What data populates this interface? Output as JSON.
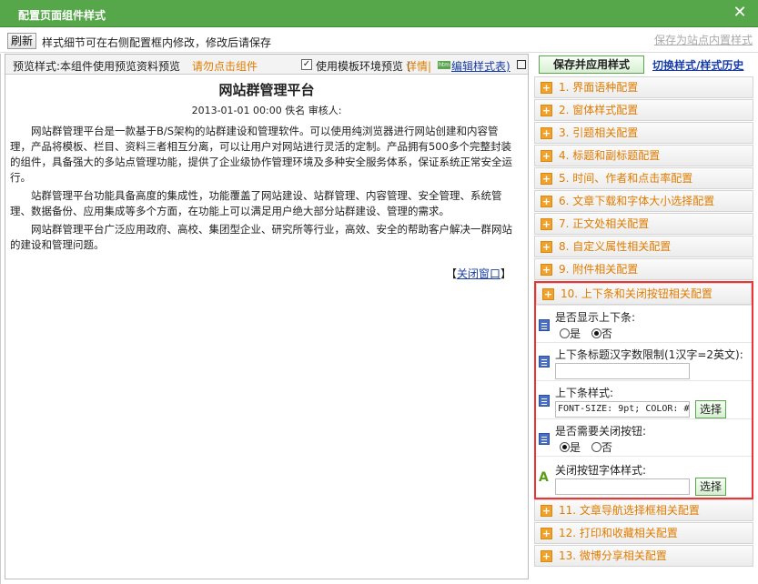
{
  "window": {
    "title": "配置页面组件样式",
    "close_icon": "close-icon"
  },
  "toolbar": {
    "refresh_label": "刷新",
    "hint": "样式细节可在右侧配置框内修改，修改后请保存",
    "save_site_label": "保存为站点内置样式"
  },
  "preview": {
    "label": "预览样式:本组件使用预览资料预览",
    "warn": "请勿点击组件",
    "use_template_checked": true,
    "use_template_label": "使用模板环境预览 (",
    "detail_label": "详情",
    "separator": "|",
    "htm_badge": "htm",
    "edit_style_label": "编辑样式表)"
  },
  "article": {
    "title": "网站群管理平台",
    "meta": "2013-01-01 00:00 佚名  审核人:",
    "paragraphs": [
      "网站群管理平台是一款基于B/S架构的站群建设和管理软件。可以使用纯浏览器进行网站创建和内容管理，产品将模板、栏目、资料三者相互分离，可以让用户对网站进行灵活的定制。产品拥有500多个完整封装的组件，具备强大的多站点管理功能，提供了企业级协作管理环境及多种安全服务体系，保证系统正常安全运行。",
      "站群管理平台功能具备高度的集成性，功能覆盖了网站建设、站群管理、内容管理、安全管理、系统管理、数据备份、应用集成等多个方面，在功能上可以满足用户绝大部分站群建设、管理的需求。",
      "网站群管理平台广泛应用政府、高校、集团型企业、研究所等行业，高效、安全的帮助客户解决一群网站的建设和管理问题。"
    ],
    "close_window_open": "【",
    "close_window_label": "关闭窗口",
    "close_window_close": "】"
  },
  "config": {
    "apply_label": "保存并应用样式",
    "switch_label": "切换样式/样式历史",
    "sections": [
      {
        "label": "1.  界面语种配置"
      },
      {
        "label": "2.  窗体样式配置"
      },
      {
        "label": "3.  引题相关配置"
      },
      {
        "label": "4.  标题和副标题配置"
      },
      {
        "label": "5.  时间、作者和点击率配置"
      },
      {
        "label": "6.  文章下载和字体大小选择配置"
      },
      {
        "label": "7.  正文处相关配置"
      },
      {
        "label": "8.  自定义属性相关配置"
      },
      {
        "label": "9.  附件相关配置"
      }
    ],
    "expanded": {
      "label": "10.  上下条和关闭按钮相关配置",
      "show_prevnext_label": "是否显示上下条:",
      "opt_yes": "是",
      "opt_no": "否",
      "show_prevnext_value": "否",
      "title_limit_label": "上下条标题汉字数限制(1汉字=2英文):",
      "title_limit_value": "",
      "prevnext_style_label": "上下条样式:",
      "prevnext_style_value": "FONT-SIZE: 9pt; COLOR: #",
      "select_label": "选择",
      "need_close_label": "是否需要关闭按钮:",
      "need_close_value": "是",
      "close_font_label": "关闭按钮字体样式:",
      "close_font_value": ""
    },
    "sections_after": [
      {
        "label": "11.  文章导航选择框相关配置"
      },
      {
        "label": "12.  打印和收藏相关配置"
      },
      {
        "label": "13.  微博分享相关配置"
      }
    ]
  }
}
